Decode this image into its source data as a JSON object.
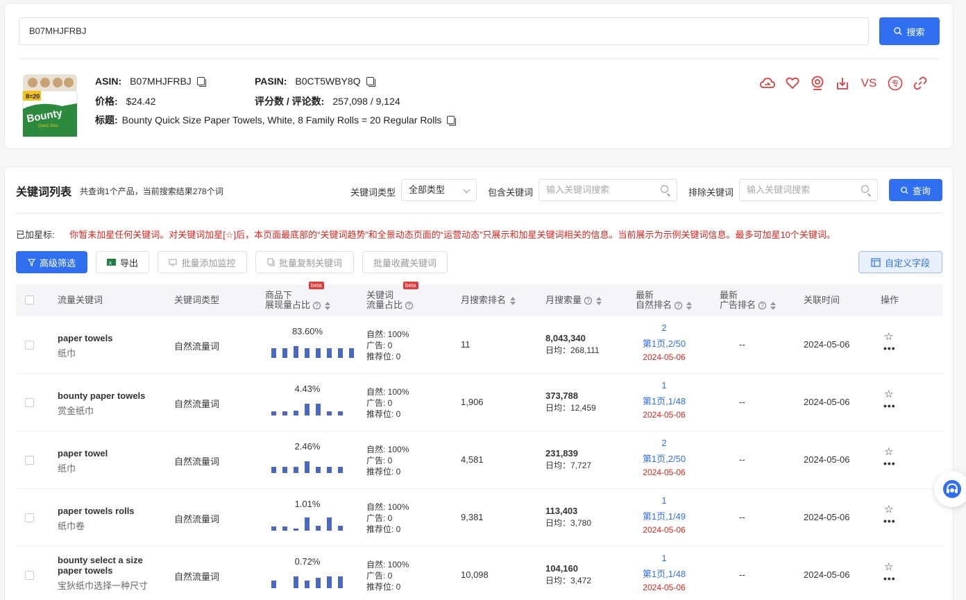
{
  "search": {
    "value": "B07MHJFRBJ",
    "button_label": "搜索"
  },
  "product": {
    "asin_label": "ASIN:",
    "asin": "B07MHJFRBJ",
    "pasin_label": "PASIN:",
    "pasin": "B0CT5WBY8Q",
    "price_label": "价格:",
    "price": "$24.42",
    "rating_label": "评分数 / 评论数:",
    "rating": "257,098 / 9,124",
    "title_label": "标题:",
    "title": "Bounty Quick Size Paper Towels, White, 8 Family Rolls = 20 Regular Rolls",
    "image_text": {
      "brand": "Bounty",
      "badge": "8=20",
      "sub": "Quick Size"
    },
    "actions": {
      "vs": "VS",
      "zhuan": "专"
    }
  },
  "list": {
    "title": "关键词列表",
    "summary": "共查询1个产品，当前搜索结果278个词",
    "type_label": "关键词类型",
    "type_value": "全部类型",
    "include_label": "包含关键词",
    "include_placeholder": "输入关键词搜索",
    "exclude_label": "排除关键词",
    "exclude_placeholder": "输入关键词搜索",
    "query_label": "查询",
    "starred_label": "已加星标:",
    "starred_msg": "你暂未加星任何关键词。对关键词加星[☆]后，本页面最底部的“关键词趋势”和全景动态页面的“运营动态”只展示和加星关键词相关的信息。当前展示为示例关键词信息。最多可加星10个关键词。",
    "toolbar": {
      "advanced": "高级筛选",
      "export": "导出",
      "batch_monitor": "批量添加监控",
      "batch_copy": "批量复制关键词",
      "batch_fav": "批量收藏关键词",
      "custom": "自定义字段"
    },
    "columns": {
      "keyword": "流量关键词",
      "type": "关键词类型",
      "impr_1": "商品下",
      "impr_2": "展现量占比",
      "share_1": "关键词",
      "share_2": "流量占比",
      "beta": "beta",
      "monthly_rank": "月搜索排名",
      "monthly_volume": "月搜索量",
      "nat_1": "最新",
      "nat_2": "自然排名",
      "ad_1": "最新",
      "ad_2": "广告排名",
      "time": "关联时间",
      "ops": "操作"
    },
    "rows": [
      {
        "kw": "paper towels",
        "kw_cn": "纸巾",
        "kw2": "",
        "type": "自然流量词",
        "pct": "83.60%",
        "bars": [
          0.7,
          0.7,
          0.85,
          0.7,
          0.7,
          0.7,
          0.7,
          0.7
        ],
        "nat": "自然: 100%",
        "ad": "广告: 0",
        "rec": "推荐位: 0",
        "rank": "11",
        "vol": "8,043,340",
        "daily": "日均：268,111",
        "nrank": "2",
        "npage": "第1页,2/50",
        "ndate": "2024-05-06",
        "adrank": "--",
        "time": "2024-05-06"
      },
      {
        "kw": "bounty paper towels",
        "kw_cn": "赏金纸巾",
        "kw2": "",
        "type": "自然流量词",
        "pct": "4.43%",
        "bars": [
          0.3,
          0.3,
          0.35,
          0.85,
          0.85,
          0.3,
          0.3,
          0
        ],
        "nat": "自然: 100%",
        "ad": "广告: 0",
        "rec": "推荐位: 0",
        "rank": "1,906",
        "vol": "373,788",
        "daily": "日均：12,459",
        "nrank": "1",
        "npage": "第1页,1/48",
        "ndate": "2024-05-06",
        "adrank": "--",
        "time": "2024-05-06"
      },
      {
        "kw": "paper towel",
        "kw_cn": "纸巾",
        "kw2": "",
        "type": "自然流量词",
        "pct": "2.46%",
        "bars": [
          0.45,
          0.45,
          0.45,
          0.85,
          0.45,
          0.45,
          0.45,
          0
        ],
        "nat": "自然: 100%",
        "ad": "广告: 0",
        "rec": "推荐位: 0",
        "rank": "4,581",
        "vol": "231,839",
        "daily": "日均：7,727",
        "nrank": "2",
        "npage": "第1页,2/50",
        "ndate": "2024-05-06",
        "adrank": "--",
        "time": "2024-05-06"
      },
      {
        "kw": "paper towels rolls",
        "kw_cn": "纸巾卷",
        "kw2": "",
        "type": "自然流量词",
        "pct": "1.01%",
        "bars": [
          0.3,
          0.3,
          0.15,
          0.95,
          0.35,
          0.95,
          0.35,
          0
        ],
        "nat": "自然: 100%",
        "ad": "广告: 0",
        "rec": "推荐位: 0",
        "rank": "9,381",
        "vol": "113,403",
        "daily": "日均：3,780",
        "nrank": "1",
        "npage": "第1页,1/49",
        "ndate": "2024-05-06",
        "adrank": "--",
        "time": "2024-05-06"
      },
      {
        "kw": "bounty select a size",
        "kw2": "paper towels",
        "kw_cn": "宝狄纸巾选择一种尺寸",
        "type": "自然流量词",
        "pct": "0.72%",
        "bars": [
          0.55,
          0,
          0.85,
          0.55,
          0.75,
          0.85,
          0.85,
          0
        ],
        "nat": "自然: 100%",
        "ad": "广告: 0",
        "rec": "推荐位: 0",
        "rank": "10,098",
        "vol": "104,160",
        "daily": "日均：3,472",
        "nrank": "1",
        "npage": "第1页,1/48",
        "ndate": "2024-05-06",
        "adrank": "--",
        "time": "2024-05-06"
      }
    ]
  },
  "colors": {
    "primary": "#2f6ff0",
    "alert": "#e0231a",
    "bar": "#4a67c6",
    "icon": "#e23a3a"
  }
}
